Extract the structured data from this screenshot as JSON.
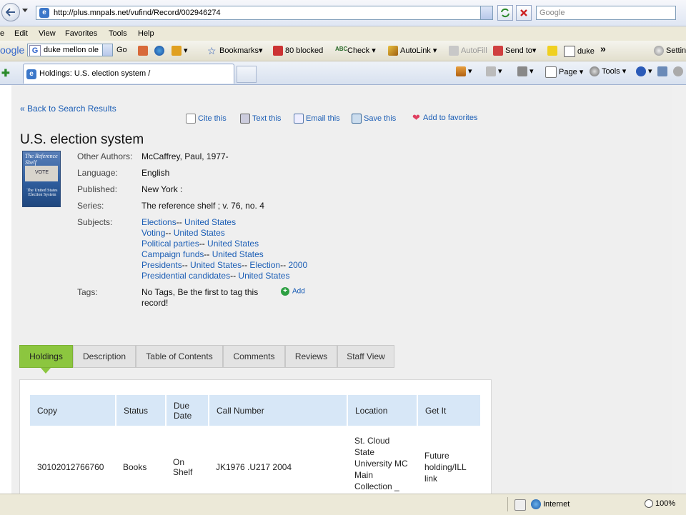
{
  "address": {
    "url": "http://plus.mnpals.net/vufind/Record/002946274",
    "search_placeholder": "Google"
  },
  "menu": [
    "e",
    "Edit",
    "View",
    "Favorites",
    "Tools",
    "Help"
  ],
  "toolbar": {
    "google_logo": "oogle",
    "google_query": "duke mellon ole",
    "go": "Go",
    "bookmarks": "Bookmarks",
    "blocked": "80 blocked",
    "check": "Check",
    "autolink": "AutoLink",
    "autofill": "AutoFill",
    "sendto": "Send to",
    "duke": "duke",
    "more": "»",
    "settings": "Settin"
  },
  "tabbar": {
    "active_tab": "Holdings: U.S. election system /",
    "page": "Page",
    "tools": "Tools"
  },
  "record": {
    "back": "« Back to Search Results",
    "actions": {
      "cite": "Cite this",
      "text": "Text this",
      "email": "Email this",
      "save": "Save this",
      "favorites": "Add to favorites"
    },
    "title": "U.S. election system",
    "cover": {
      "series_line": "The Reference Shelf",
      "vote": "VOTE",
      "title_line": "The United States Election System"
    },
    "labels": {
      "authors": "Other Authors:",
      "language": "Language:",
      "published": "Published:",
      "series": "Series:",
      "subjects": "Subjects:",
      "tags": "Tags:"
    },
    "authors": "McCaffrey, Paul, 1977-",
    "language": "English",
    "published": "New York :",
    "series": "The reference shelf ; v. 76, no. 4",
    "subjects": [
      {
        "a": "Elections",
        "b": "United States"
      },
      {
        "a": "Voting",
        "b": "United States"
      },
      {
        "a": "Political parties",
        "b": "United States"
      },
      {
        "a": "Campaign funds",
        "b": "United States"
      },
      {
        "a": "Presidents",
        "b": "United States",
        "c": "Election",
        "d": "2000"
      },
      {
        "a": "Presidential candidates",
        "b": "United States"
      }
    ],
    "tags_text_1": "No Tags, Be the first to tag this",
    "tags_text_2": "record!",
    "tags_add": "Add"
  },
  "tabs": [
    "Holdings",
    "Description",
    "Table of Contents",
    "Comments",
    "Reviews",
    "Staff View"
  ],
  "holdings": {
    "headers": [
      "Copy",
      "Status",
      "Due Date",
      "Call Number",
      "Location",
      "Get It"
    ],
    "rows": [
      {
        "copy": "30102012766760",
        "status": "Books",
        "due": "On Shelf",
        "call": "JK1976 .U217 2004",
        "location": "St. Cloud State University MC Main Collection _ Permanent",
        "getit": "Future holding/ILL link"
      }
    ]
  },
  "status": {
    "zone": "Internet",
    "zoom": "100%"
  }
}
